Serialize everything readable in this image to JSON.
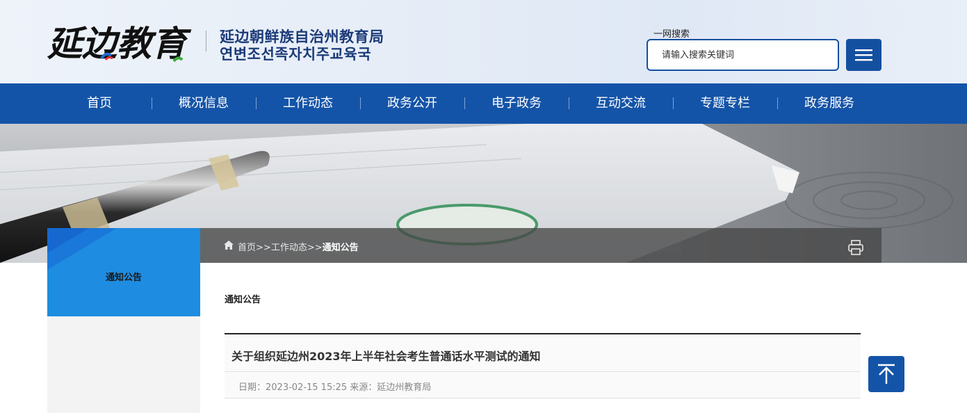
{
  "header": {
    "calligraphy": "延边教育",
    "title_cn": "延边朝鲜族自治州教育局",
    "title_kr": "연변조선족자치주교육국",
    "search_label": "一网搜索",
    "search_placeholder": "请输入搜索关键词",
    "menu_icon": "hamburger-menu-icon"
  },
  "nav": {
    "items": [
      "首页",
      "概况信息",
      "工作动态",
      "政务公开",
      "电子政务",
      "互动交流",
      "专题专栏",
      "政务服务"
    ]
  },
  "breadcrumb": {
    "home": "首页",
    "sep1": ">>",
    "level1": "工作动态",
    "sep2": ">>",
    "current": "通知公告"
  },
  "sidebar": {
    "title": "通知公告"
  },
  "content": {
    "section_title": "通知公告",
    "article_title": "关于组织延边州2023年上半年社会考生普通话水平测试的通知",
    "article_meta": "日期：2023-02-15 15:25 来源：延边州教育局"
  },
  "colors": {
    "nav_bg": "#1454a8",
    "sidebar_head": "#1e8ce0",
    "brand_text": "#1b3a78"
  }
}
